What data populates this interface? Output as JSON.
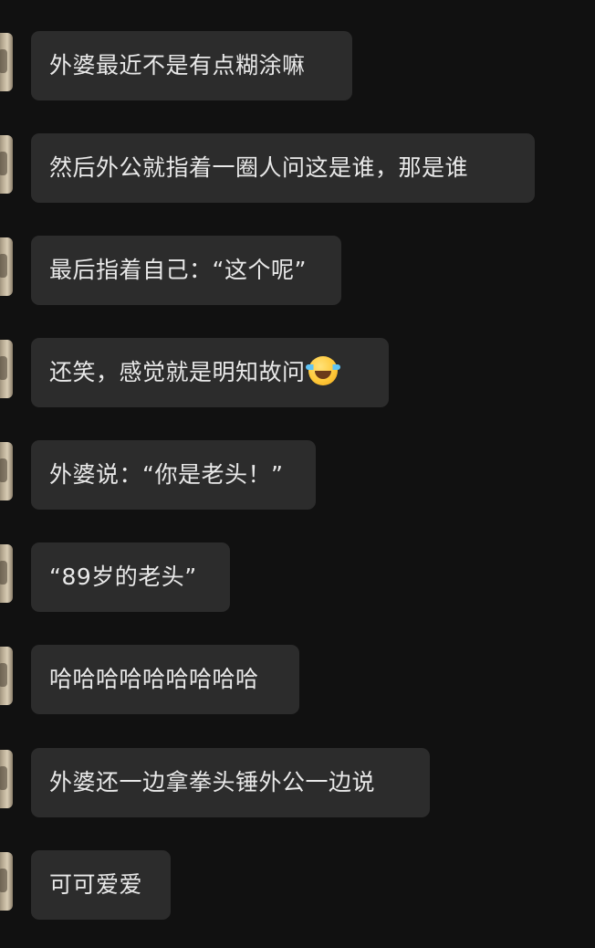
{
  "theme": {
    "background": "#111111",
    "bubble": "#2c2c2c",
    "text": "#e9e9e9"
  },
  "messages": [
    {
      "text": "外婆最近不是有点糊涂嘛"
    },
    {
      "text": "然后外公就指着一圈人问这是谁，那是谁"
    },
    {
      "text": "最后指着自己：“这个呢”"
    },
    {
      "text": "还笑，感觉就是明知故问",
      "emoji": "face-with-tears-of-joy"
    },
    {
      "text": "外婆说：“你是老头！”"
    },
    {
      "text": "“89岁的老头”"
    },
    {
      "text": "哈哈哈哈哈哈哈哈哈"
    },
    {
      "text": "外婆还一边拿拳头锤外公一边说"
    },
    {
      "text": "可可爱爱"
    }
  ]
}
